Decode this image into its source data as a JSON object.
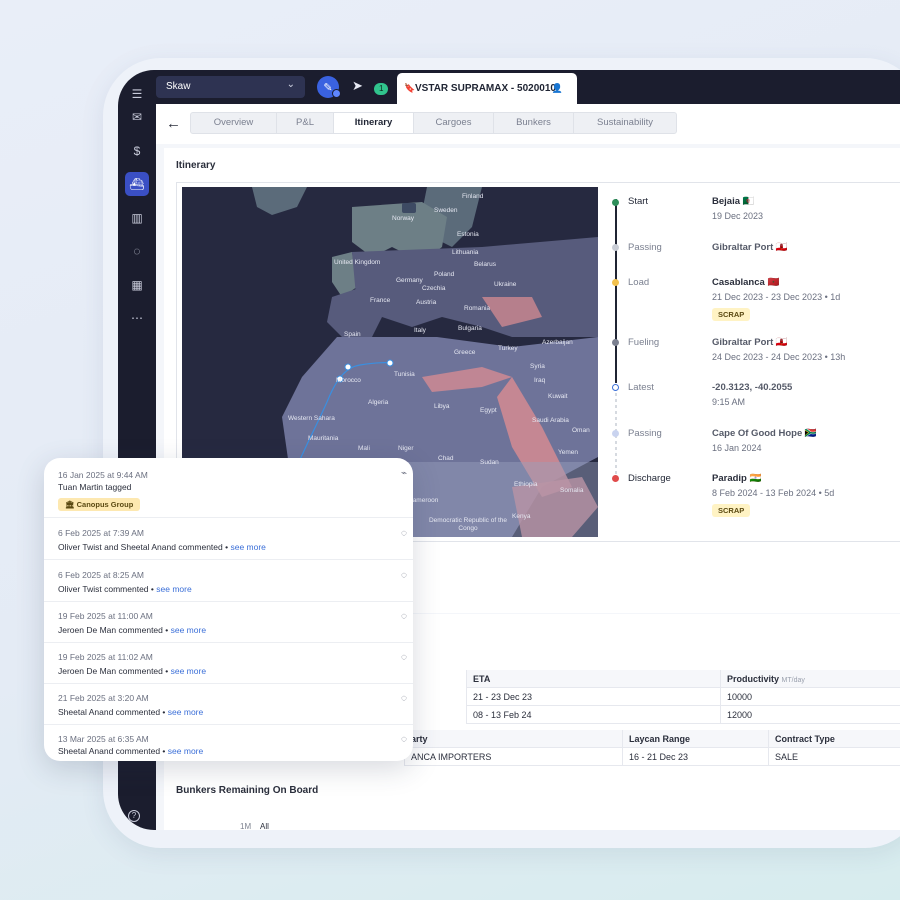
{
  "topbar": {
    "vessel_select": "Skaw",
    "notification_count": "1",
    "vessel_tab": "VSTAR SUPRAMAX - 5020010"
  },
  "tabs": [
    "Overview",
    "P&L",
    "Itinerary",
    "Cargoes",
    "Bunkers",
    "Sustainability"
  ],
  "itinerary": {
    "title": "Itinerary",
    "map_labels": {
      "finland": "Finland",
      "sweden": "Sweden",
      "norway": "Norway",
      "estonia": "Estonia",
      "lithuania": "Lithuania",
      "belarus": "Belarus",
      "united_kingdom": "United Kingdom",
      "poland": "Poland",
      "ukraine": "Ukraine",
      "germany": "Germany",
      "czechia": "Czechia",
      "france": "France",
      "austria": "Austria",
      "romania": "Romania",
      "italy": "Italy",
      "spain": "Spain",
      "bulgaria": "Bulgaria",
      "greece": "Greece",
      "turkey": "Turkey",
      "azerbaijan": "Azerbaijan",
      "morocco": "Morocco",
      "tunisia": "Tunisia",
      "syria": "Syria",
      "iraq": "Iraq",
      "algeria": "Algeria",
      "libya": "Libya",
      "egypt": "Egypt",
      "kuwait": "Kuwait",
      "western_sahara": "Western Sahara",
      "mauritania": "Mauritania",
      "mali": "Mali",
      "niger": "Niger",
      "chad": "Chad",
      "sudan": "Sudan",
      "saudi_arabia": "Saudi Arabia",
      "oman": "Oman",
      "yemen": "Yemen",
      "cameroon": "Cameroon",
      "ethiopia": "Ethiopia",
      "somalia": "Somalia",
      "kenya": "Kenya",
      "drc": "Democratic Republic of the Congo"
    },
    "stops": [
      {
        "type": "Start",
        "port": "Bejaia 🇩🇿",
        "date": "19 Dec 2023",
        "tag": "",
        "color": "#2f8f5b"
      },
      {
        "type": "Passing",
        "port": "Gibraltar Port 🇬🇮",
        "date": "",
        "tag": "",
        "color": "#c9cdd6"
      },
      {
        "type": "Load",
        "port": "Casablanca 🇲🇦",
        "date": "21 Dec 2023 - 23 Dec 2023 • 1d",
        "tag": "SCRAP",
        "color": "#f2c14e"
      },
      {
        "type": "Fueling",
        "port": "Gibraltar Port 🇬🇮",
        "date": "24 Dec 2023 - 24 Dec 2023 • 13h",
        "tag": "",
        "color": "#7b8090"
      },
      {
        "type": "Latest",
        "port": "-20.3123, -40.2055",
        "date": "9:15 AM",
        "tag": "",
        "color": "#3b6fd8"
      },
      {
        "type": "Passing",
        "port": "Cape Of Good Hope 🇿🇦",
        "date": "16 Jan 2024",
        "tag": "",
        "color": "#c9cdd6"
      },
      {
        "type": "Discharge",
        "port": "Paradip 🇮🇳",
        "date": "8 Feb 2024 - 13 Feb 2024 • 5d",
        "tag": "SCRAP",
        "color": "#e04b4b"
      }
    ]
  },
  "ports_table": {
    "headers": [
      "ETA",
      "Productivity"
    ],
    "productivity_unit": "MT/day",
    "rows": [
      [
        "21 - 23 Dec 23",
        "10000"
      ],
      [
        "08 - 13 Feb 24",
        "12000"
      ]
    ]
  },
  "cargo_table": {
    "headers": [
      "arty",
      "Laycan Range",
      "Contract Type"
    ],
    "rows": [
      [
        "ANCA IMPORTERS",
        "16 - 21 Dec 23",
        "SALE"
      ]
    ]
  },
  "bunkers": {
    "title": "Bunkers Remaining On Board",
    "range_1m": "1M",
    "range_all": "All"
  },
  "activity": [
    {
      "time": "16 Jan 2025 at 9:44 AM",
      "text": "Tuan Martin tagged",
      "tag": "Canopus Group",
      "icon": "tag-icon"
    },
    {
      "time": "6 Feb 2025 at 7:39 AM",
      "text": "Oliver Twist and Sheetal Anand commented •",
      "more": "see more",
      "icon": "comment-icon"
    },
    {
      "time": "6 Feb 2025 at 8:25 AM",
      "text": "Oliver Twist commented •",
      "more": "see more",
      "icon": "comment-icon"
    },
    {
      "time": "19 Feb 2025 at 11:00 AM",
      "text": "Jeroen De Man commented •",
      "more": "see more",
      "icon": "comment-icon"
    },
    {
      "time": "19 Feb 2025 at 11:02 AM",
      "text": "Jeroen De Man commented •",
      "more": "see more",
      "icon": "comment-icon"
    },
    {
      "time": "21 Feb 2025 at 3:20 AM",
      "text": "Sheetal Anand commented •",
      "more": "see more",
      "icon": "comment-icon"
    },
    {
      "time": "13 Mar 2025 at 6:35 AM",
      "text": "Sheetal Anand commented •",
      "more": "see more",
      "icon": "comment-icon"
    }
  ]
}
